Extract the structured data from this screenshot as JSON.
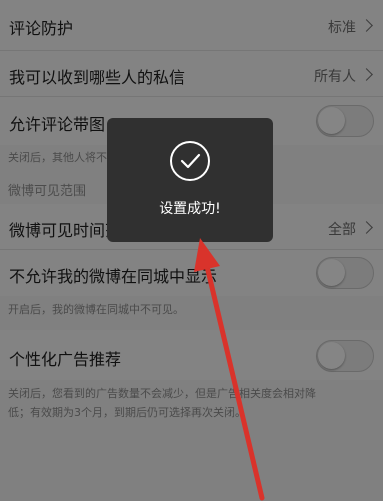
{
  "rows": {
    "comment_protection": {
      "label": "评论防护",
      "value": "标准"
    },
    "private_messages": {
      "label": "我可以收到哪些人的私信",
      "value": "所有人"
    },
    "allow_image_comments": {
      "label": "允许评论带图",
      "note": "关闭后，其他人将不能在评论中发布带图片的评论",
      "on": false
    },
    "weibo_visible_time": {
      "label": "微博可见时间范围",
      "value": "全部"
    },
    "hide_in_city": {
      "label": "不允许我的微博在同城中显示",
      "note": "开启后，我的微博在同城中不可见。",
      "on": false
    },
    "personalized_ads": {
      "label": "个性化广告推荐",
      "note_line1": "关闭后，您看到的广告数量不会减少，但是广告相关度会相对降",
      "note_line2": "低；有效期为3个月，到期后仍可选择再次关闭。",
      "on": false
    }
  },
  "section": {
    "visibility_title": "微博可见范围"
  },
  "toast": {
    "message": "设置成功!"
  },
  "colors": {
    "overlay_bg": "#808080",
    "toast_bg": "#303030",
    "arrow": "#d9332b"
  }
}
